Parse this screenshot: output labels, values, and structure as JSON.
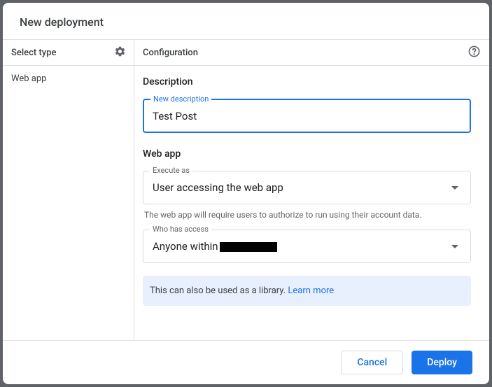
{
  "dialog": {
    "title": "New deployment"
  },
  "left": {
    "headerLabel": "Select type",
    "typeItem": "Web app"
  },
  "right": {
    "headerLabel": "Configuration"
  },
  "description": {
    "sectionLabel": "Description",
    "legend": "New description",
    "value": "Test Post"
  },
  "webapp": {
    "sectionLabel": "Web app",
    "executeAs": {
      "legend": "Execute as",
      "value": "User accessing the web app",
      "helper": "The web app will require users to authorize to run using their account data."
    },
    "access": {
      "legend": "Who has access",
      "valuePrefix": "Anyone within"
    }
  },
  "banner": {
    "text": "This can also be used as a library. ",
    "linkText": "Learn more"
  },
  "footer": {
    "cancel": "Cancel",
    "deploy": "Deploy"
  }
}
